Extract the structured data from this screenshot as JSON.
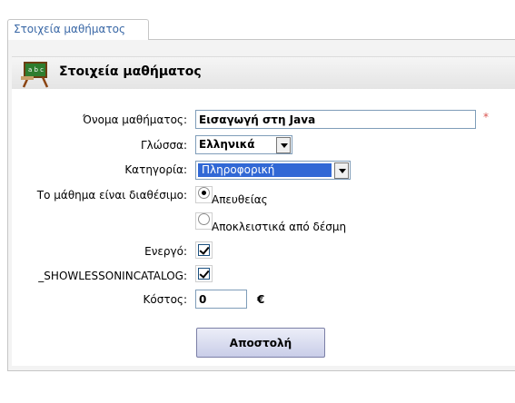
{
  "tab": {
    "label": "Στοιχεία μαθήματος"
  },
  "header": {
    "title": "Στοιχεία μαθήματος",
    "icon": "blackboard-abc-icon"
  },
  "form": {
    "lesson_name": {
      "label": "Όνομα μαθήματος:",
      "value": "Εισαγωγή στη Java",
      "required_mark": "*"
    },
    "language": {
      "label": "Γλώσσα:",
      "value": "Ελληνικά"
    },
    "category": {
      "label": "Κατηγορία:",
      "value": "Πληροφορική"
    },
    "availability": {
      "label": "Το μάθημα είναι διαθέσιμο:",
      "options": [
        {
          "label": "Απευθείας",
          "checked": true
        },
        {
          "label": "Αποκλειστικά από δέσμη",
          "checked": false
        }
      ]
    },
    "active": {
      "label": "Ενεργό:",
      "checked": true
    },
    "show_in_catalog": {
      "label": "_SHOWLESSONINCATALOG:",
      "checked": true
    },
    "cost": {
      "label": "Κόστος:",
      "value": "0",
      "currency": "€"
    },
    "submit_label": "Αποστολή"
  },
  "colors": {
    "accent": "#3168d5",
    "tab_text": "#3a68a6",
    "required": "#d9534f"
  }
}
